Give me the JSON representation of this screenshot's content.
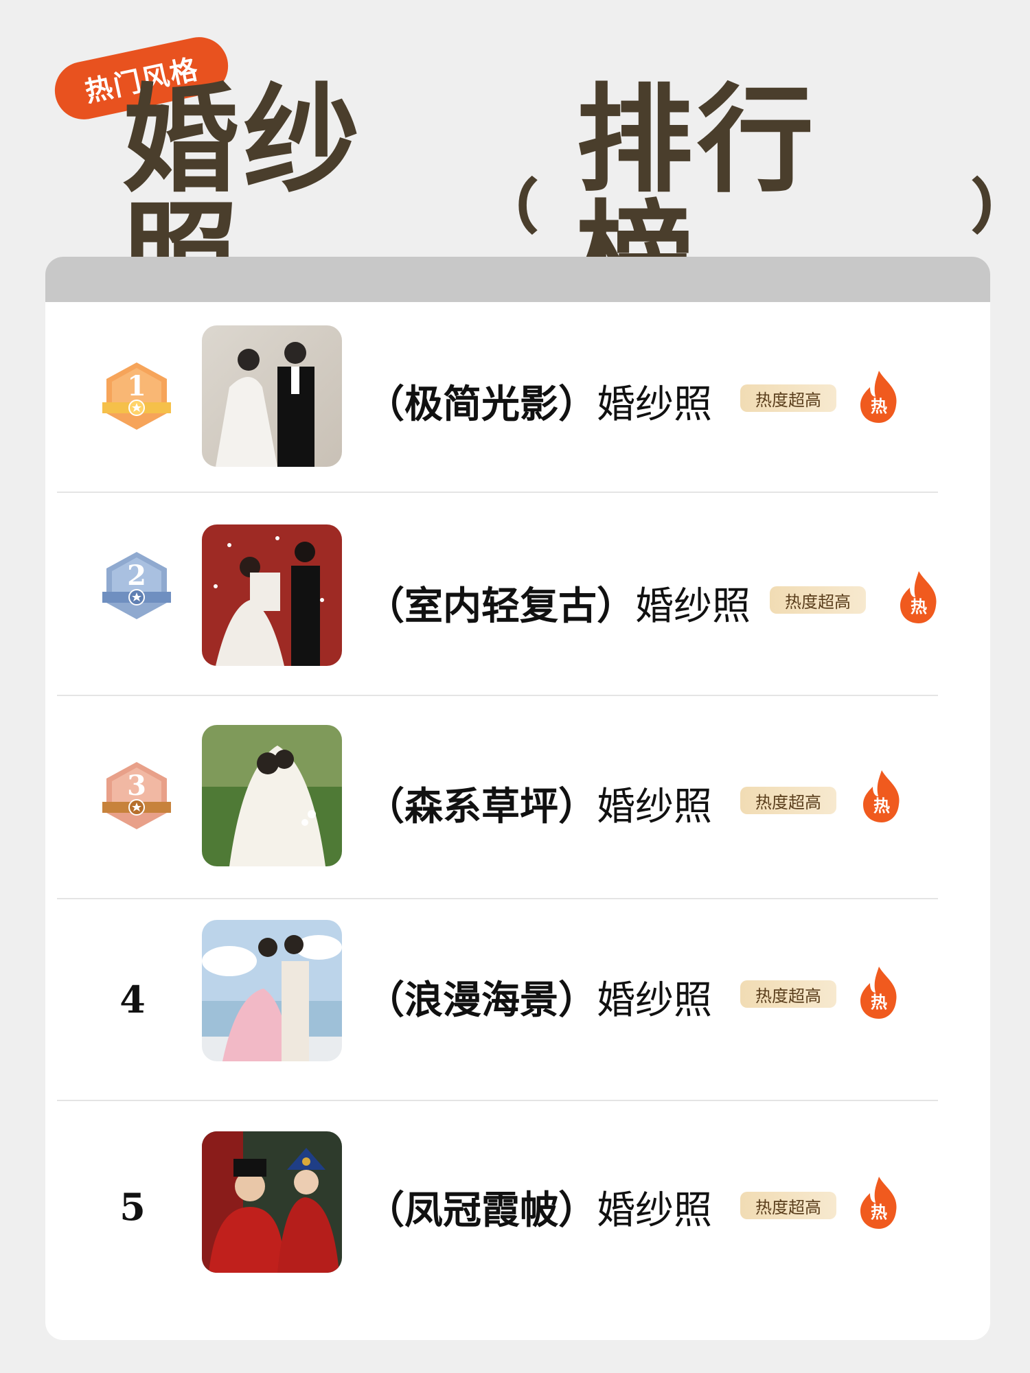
{
  "header": {
    "tag": "热门风格",
    "title": "婚纱照",
    "bracket_open": "﹙",
    "subtitle": "排行榜",
    "bracket_close": "﹚"
  },
  "items": [
    {
      "rank": "1",
      "style": "（极简光影）",
      "suffix": "婚纱照",
      "tag": "热度超高",
      "hot": "热",
      "badge": "gold"
    },
    {
      "rank": "2",
      "style": "（室内轻复古）",
      "suffix": "婚纱照",
      "tag": "热度超高",
      "hot": "热",
      "badge": "silver"
    },
    {
      "rank": "3",
      "style": "（森系草坪）",
      "suffix": "婚纱照",
      "tag": "热度超高",
      "hot": "热",
      "badge": "bronze"
    },
    {
      "rank": "4",
      "style": "（浪漫海景）",
      "suffix": "婚纱照",
      "tag": "热度超高",
      "hot": "热",
      "badge": "none"
    },
    {
      "rank": "5",
      "style": "（凤冠霞帔）",
      "suffix": "婚纱照",
      "tag": "热度超高",
      "hot": "热",
      "badge": "none"
    }
  ],
  "colors": {
    "title": "#4a3e2c",
    "tag_pill": "#e8521f",
    "flame": "#f05a1e",
    "gold_badge": "#f29a4a",
    "silver_badge": "#8aa6d0",
    "bronze_badge": "#e7a086"
  }
}
